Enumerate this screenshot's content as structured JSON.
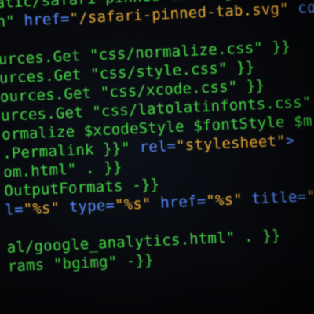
{
  "lines": [
    {
      "segments": [
        {
          "text": "atic/safari-pinned-tab.svg\") -}}",
          "color": "green"
        }
      ]
    },
    {
      "segments": [
        {
          "text": "n\" ",
          "color": "green"
        },
        {
          "text": "href=",
          "color": "blue"
        },
        {
          "text": "\"/safari-pinned-tab.svg\" ",
          "color": "orange"
        },
        {
          "text": "col",
          "color": "blue"
        }
      ]
    },
    {
      "segments": []
    },
    {
      "segments": [
        {
          "text": "urces.Get \"css/normalize.css\" }}",
          "color": "green"
        }
      ]
    },
    {
      "segments": [
        {
          "text": "urces.Get \"css/style.css\" }}",
          "color": "green"
        }
      ]
    },
    {
      "segments": [
        {
          "text": "ources.Get \"css/xcode.css\" }}",
          "color": "green"
        }
      ]
    },
    {
      "segments": [
        {
          "text": "urces.Get \"css/latolatinfonts.css\"",
          "color": "green"
        }
      ]
    },
    {
      "segments": [
        {
          "text": "ormalize $xcodeStyle $fontStyle $m",
          "color": "green"
        }
      ]
    },
    {
      "segments": [
        {
          "text": ".Permalink }}\" ",
          "color": "green"
        },
        {
          "text": "rel=",
          "color": "blue"
        },
        {
          "text": "\"stylesheet\"",
          "color": "orange"
        },
        {
          "text": ">",
          "color": "blue"
        }
      ]
    },
    {
      "segments": [
        {
          "text": "om.html\" . }}",
          "color": "green"
        }
      ]
    },
    {
      "segments": [
        {
          "text": "OutputFormats -}}",
          "color": "green"
        }
      ]
    },
    {
      "segments": [
        {
          "text": "l=",
          "color": "blue"
        },
        {
          "text": "\"%s\" ",
          "color": "orange"
        },
        {
          "text": "type=",
          "color": "blue"
        },
        {
          "text": "\"%s\" ",
          "color": "orange"
        },
        {
          "text": "href=",
          "color": "blue"
        },
        {
          "text": "\"%s\" ",
          "color": "orange"
        },
        {
          "text": "title=",
          "color": "blue"
        },
        {
          "text": "\"",
          "color": "orange"
        }
      ]
    },
    {
      "segments": []
    },
    {
      "segments": [
        {
          "text": "al/google_analytics.html\" . }}",
          "color": "green"
        }
      ]
    },
    {
      "segments": [
        {
          "text": "rams \"bgimg\" -}}",
          "color": "green"
        }
      ]
    }
  ],
  "colors": {
    "green": "#3fca3f",
    "orange": "#e09a2e",
    "blue": "#4f7dff",
    "background": "#07080c"
  }
}
